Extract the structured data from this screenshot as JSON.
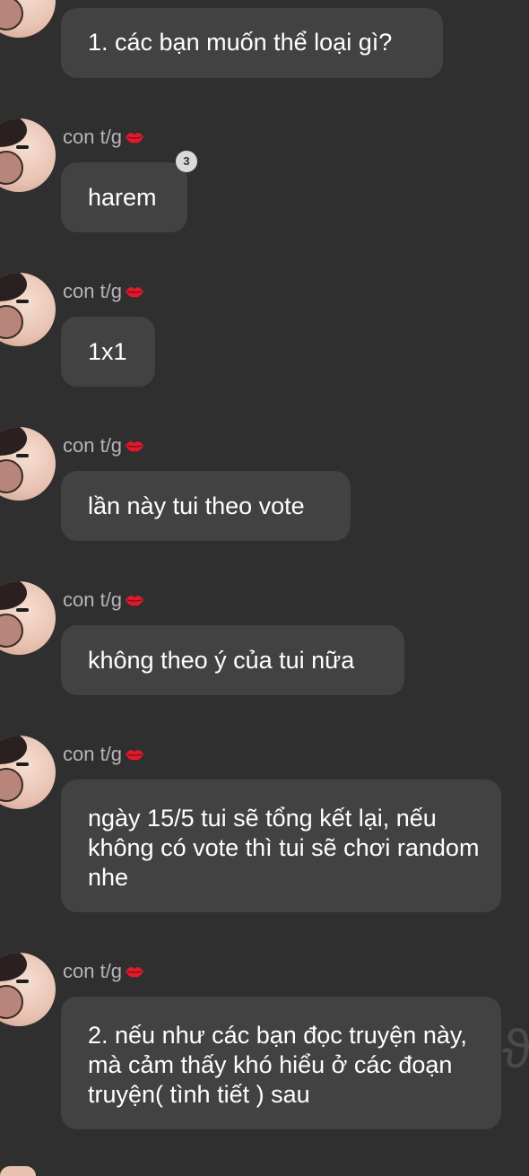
{
  "messages": [
    {
      "text": "1. các bạn muốn thể loại gì?"
    },
    {
      "sender": "con t/g",
      "text": "harem",
      "reaction_count": "3"
    },
    {
      "sender": "con t/g",
      "text": "1x1"
    },
    {
      "sender": "con t/g",
      "text": "lần này tui theo vote"
    },
    {
      "sender": "con t/g",
      "text": "không theo ý của tui nữa"
    },
    {
      "sender": "con t/g",
      "text": "ngày 15/5 tui sẽ tổng kết lại, nếu không có vote thì tui sẽ chơi random nhe"
    },
    {
      "sender": "con t/g",
      "text": "2. nếu như các bạn đọc truyện này, mà cảm thấy khó hiểu ở các đoạn truyện( tình tiết ) sau"
    }
  ],
  "icons": {
    "sender_badge": "red-lips-icon"
  },
  "colors": {
    "background": "#2f2f2f",
    "bubble": "#424242",
    "sender_text": "#b5b5b5"
  }
}
